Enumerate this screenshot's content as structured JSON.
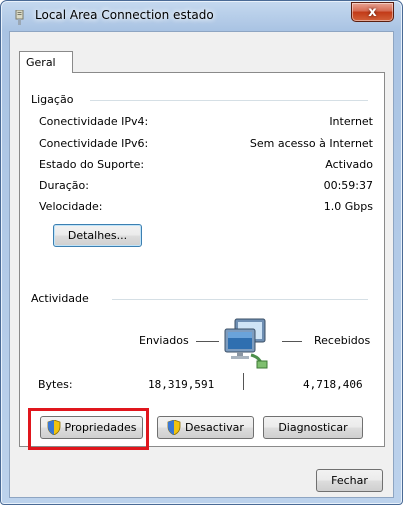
{
  "window": {
    "title": "Local Area Connection estado",
    "close_label": "x"
  },
  "tabs": [
    {
      "label": "Geral"
    }
  ],
  "connection": {
    "group_label": "Ligação",
    "rows": [
      {
        "label": "Conectividade IPv4:",
        "value": "Internet"
      },
      {
        "label": "Conectividade IPv6:",
        "value": "Sem acesso à Internet"
      },
      {
        "label": "Estado do Suporte:",
        "value": "Activado"
      },
      {
        "label": "Duração:",
        "value": "00:59:37"
      },
      {
        "label": "Velocidade:",
        "value": "1.0 Gbps"
      }
    ],
    "details_button": "Detalhes..."
  },
  "activity": {
    "group_label": "Actividade",
    "sent_label": "Enviados",
    "received_label": "Recebidos",
    "bytes_label": "Bytes:",
    "bytes_sent": "18,319,591",
    "bytes_received": "4,718,406"
  },
  "buttons": {
    "properties": "Propriedades",
    "disable": "Desactivar",
    "diagnose": "Diagnosticar",
    "close": "Fechar"
  },
  "icons": {
    "title": "network-adapter-icon",
    "activity": "network-computers-icon",
    "shield": "uac-shield-icon"
  },
  "colors": {
    "highlight": "#e0161d",
    "close_button": "#c23a17"
  }
}
